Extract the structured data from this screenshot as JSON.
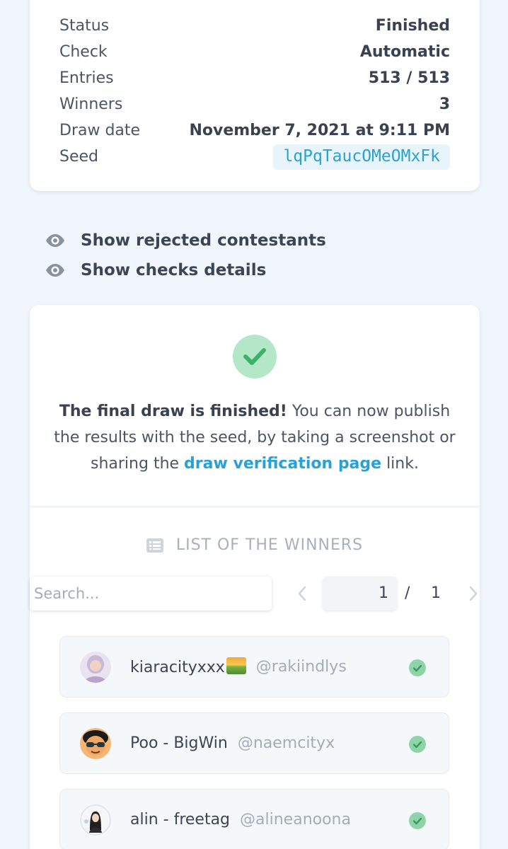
{
  "summary": {
    "rows": [
      {
        "label": "Status",
        "value": "Finished"
      },
      {
        "label": "Check",
        "value": "Automatic"
      },
      {
        "label": "Entries",
        "value": "513 / 513"
      },
      {
        "label": "Winners",
        "value": "3"
      },
      {
        "label": "Draw date",
        "value": "November 7, 2021 at 9:11 PM"
      }
    ],
    "seed_label": "Seed",
    "seed_value": "lqPqTaucOMeOMxFk"
  },
  "toggles": {
    "rejected": "Show rejected contestants",
    "checks": "Show checks details"
  },
  "result": {
    "message_strong": "The final draw is finished!",
    "message_part1": " You can now publish the results with the seed, by taking a screenshot or sharing the ",
    "link_text": "draw verification page",
    "message_part2": " link."
  },
  "winners": {
    "heading": "LIST OF THE WINNERS",
    "search_placeholder": "Search...",
    "page_current": "1",
    "page_separator": "/",
    "page_total": "1",
    "items": [
      {
        "name": "kiaracityxxx",
        "handle": "@rakiindlys"
      },
      {
        "name": "Poo - BigWin",
        "handle": "@naemcityx"
      },
      {
        "name": "alin - freetag",
        "handle": "@alineanoona"
      }
    ]
  },
  "colors": {
    "accent": "#2aa1d5",
    "success": "#8fd4a9",
    "success_light": "#b4e6c8",
    "background": "#f0f6fc"
  },
  "icons": {
    "toggle_icon": "eye-icon",
    "heading_icon": "list-icon",
    "status_icon": "check-circle-icon"
  }
}
